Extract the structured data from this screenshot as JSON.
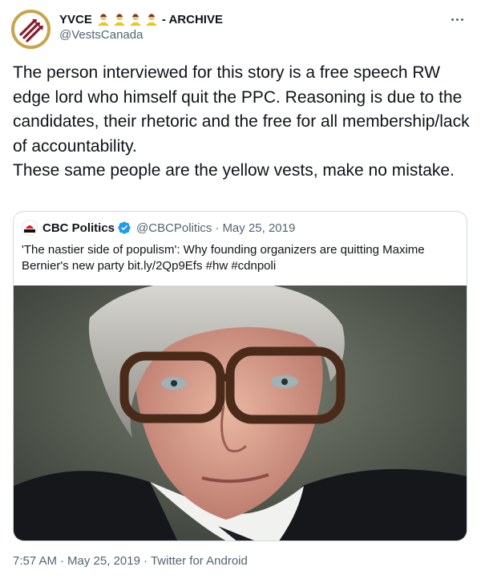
{
  "author": {
    "name": "YVCE",
    "suffix": "- ARCHIVE",
    "handle": "@VestsCanada",
    "emoji_icons": [
      "vest-person-emoji",
      "vest-person-emoji",
      "vest-person-emoji",
      "vest-person-emoji"
    ]
  },
  "tweet": {
    "paragraphs": [
      "The person interviewed for this story is a free speech RW edge lord who himself quit the PPC. Reasoning is due to the candidates, their rhetoric and the free for all membership/lack of accountability.",
      "These same people are the yellow vests, make no mistake."
    ]
  },
  "quoted": {
    "name": "CBC Politics",
    "handle": "@CBCPolitics",
    "separator": "·",
    "date": "May 25, 2019",
    "text": "'The nastier side of populism': Why founding organizers are quitting Maxime Bernier's new party bit.ly/2Qp9Efs #hw #cdnpoli",
    "verified": true
  },
  "meta": {
    "time": "7:57 AM",
    "separator": "·",
    "date": "May 25, 2019",
    "source": "Twitter for Android"
  },
  "colors": {
    "text": "#0f1419",
    "secondary": "#536471",
    "border": "#cfd9de",
    "verified": "#1d9bf0",
    "avatar_ring": "#c9a449",
    "avatar_stripes": "#8b1a2b"
  }
}
